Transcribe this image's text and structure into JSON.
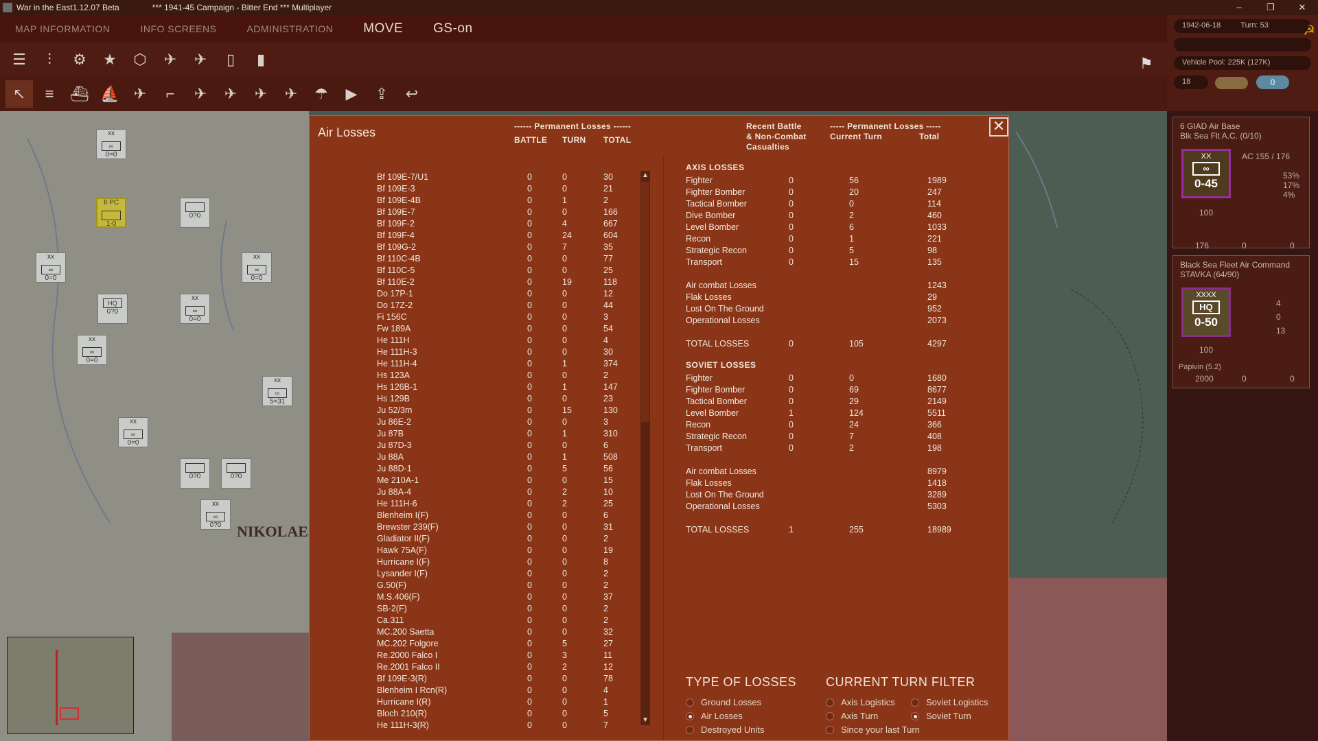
{
  "window": {
    "app_title": "War in the East1.12.07 Beta",
    "campaign_title": "***   1941-45 Campaign - Bitter End   ***  Multiplayer",
    "minimize": "–",
    "maximize": "❐",
    "close": "✕"
  },
  "menubar": {
    "items": [
      "MAP INFORMATION",
      "INFO SCREENS",
      "ADMINISTRATION",
      "MOVE",
      "GS-on"
    ]
  },
  "status": {
    "date": "1942-06-18",
    "turn": "Turn: 53",
    "vehicle_pool": "Vehicle Pool: 225K (127K)",
    "counter": "18",
    "indicator": "0"
  },
  "map": {
    "city_label": "NIKOLAE",
    "counters": [
      {
        "top": "xx",
        "val": "0=0"
      },
      {
        "top": "II PC",
        "val": "1-0"
      },
      {
        "top": "",
        "val": "0?0"
      },
      {
        "top": "xx",
        "val": "0=0"
      },
      {
        "top": "xx",
        "val": "0=0"
      },
      {
        "top": "HQ",
        "val": "0?0"
      },
      {
        "top": "xx",
        "val": "0=0"
      },
      {
        "top": "xx",
        "val": "0=0"
      },
      {
        "top": "xx",
        "val": "5=31"
      },
      {
        "top": "xx",
        "val": "0=0"
      },
      {
        "top": "",
        "val": "0?0"
      },
      {
        "top": "",
        "val": "0?0"
      },
      {
        "top": "xx",
        "val": "0?0"
      }
    ]
  },
  "right_panel": {
    "unit1": {
      "name": "6 GIAD Air Base",
      "subname": "Blk Sea Flt A.C. (0/10)",
      "corps": "XX",
      "strength": "0-45",
      "ac": "AC  155 / 176",
      "pct1": "53%",
      "pct2": "17%",
      "pct3": "4%",
      "morale": "100",
      "planes": "176",
      "stat2": "0",
      "stat3": "0"
    },
    "unit2": {
      "name": "Black Sea Fleet Air Command",
      "subname": "STAVKA  (64/90)",
      "corps": "XXXX",
      "hq": "HQ",
      "strength": "0-50",
      "s1": "4",
      "s2": "0",
      "s3": "13",
      "morale": "100",
      "leader": "Papivin (5.2)",
      "men": "2000",
      "a": "0",
      "b": "0"
    }
  },
  "dialog": {
    "title": "Air Losses",
    "perm_header_left": "------ Permanent Losses ------",
    "col_battle": "BATTLE",
    "col_turn": "TURN",
    "col_total": "TOTAL",
    "recent_header": "Recent Battle\n& Non-Combat\nCasualties",
    "perm_header_right": "----- Permanent Losses -----",
    "col_current_turn": "Current Turn",
    "col_total_right": "Total",
    "close": "✕",
    "rows": [
      [
        "Bf 109E-7/U1",
        "0",
        "0",
        "30"
      ],
      [
        "Bf 109E-3",
        "0",
        "0",
        "21"
      ],
      [
        "Bf 109E-4B",
        "0",
        "1",
        "2"
      ],
      [
        "Bf 109E-7",
        "0",
        "0",
        "166"
      ],
      [
        "Bf 109F-2",
        "0",
        "4",
        "667"
      ],
      [
        "Bf 109F-4",
        "0",
        "24",
        "604"
      ],
      [
        "Bf 109G-2",
        "0",
        "7",
        "35"
      ],
      [
        "Bf 110C-4B",
        "0",
        "0",
        "77"
      ],
      [
        "Bf 110C-5",
        "0",
        "0",
        "25"
      ],
      [
        "Bf 110E-2",
        "0",
        "19",
        "118"
      ],
      [
        "Do 17P-1",
        "0",
        "0",
        "12"
      ],
      [
        "Do 17Z-2",
        "0",
        "0",
        "44"
      ],
      [
        "Fi 156C",
        "0",
        "0",
        "3"
      ],
      [
        "Fw 189A",
        "0",
        "0",
        "54"
      ],
      [
        "He 111H",
        "0",
        "0",
        "4"
      ],
      [
        "He 111H-3",
        "0",
        "0",
        "30"
      ],
      [
        "He 111H-4",
        "0",
        "1",
        "374"
      ],
      [
        "Hs 123A",
        "0",
        "0",
        "2"
      ],
      [
        "Hs 126B-1",
        "0",
        "1",
        "147"
      ],
      [
        "Hs 129B",
        "0",
        "0",
        "23"
      ],
      [
        "Ju 52/3m",
        "0",
        "15",
        "130"
      ],
      [
        "Ju 86E-2",
        "0",
        "0",
        "3"
      ],
      [
        "Ju 87B",
        "0",
        "1",
        "310"
      ],
      [
        "Ju 87D-3",
        "0",
        "0",
        "6"
      ],
      [
        "Ju 88A",
        "0",
        "1",
        "508"
      ],
      [
        "Ju 88D-1",
        "0",
        "5",
        "56"
      ],
      [
        "Me 210A-1",
        "0",
        "0",
        "15"
      ],
      [
        "Ju 88A-4",
        "0",
        "2",
        "10"
      ],
      [
        "He 111H-6",
        "0",
        "2",
        "25"
      ],
      [
        "Blenheim I(F)",
        "0",
        "0",
        "6"
      ],
      [
        "Brewster 239(F)",
        "0",
        "0",
        "31"
      ],
      [
        "Gladiator II(F)",
        "0",
        "0",
        "2"
      ],
      [
        "Hawk 75A(F)",
        "0",
        "0",
        "19"
      ],
      [
        "Hurricane I(F)",
        "0",
        "0",
        "8"
      ],
      [
        "Lysander I(F)",
        "0",
        "0",
        "2"
      ],
      [
        "G.50(F)",
        "0",
        "0",
        "2"
      ],
      [
        "M.S.406(F)",
        "0",
        "0",
        "37"
      ],
      [
        "SB-2(F)",
        "0",
        "0",
        "2"
      ],
      [
        "Ca.311",
        "0",
        "0",
        "2"
      ],
      [
        "MC.200 Saetta",
        "0",
        "0",
        "32"
      ],
      [
        "MC.202 Folgore",
        "0",
        "5",
        "27"
      ],
      [
        "Re.2000 Falco I",
        "0",
        "3",
        "11"
      ],
      [
        "Re.2001 Falco II",
        "0",
        "2",
        "12"
      ],
      [
        "Bf 109E-3(R)",
        "0",
        "0",
        "78"
      ],
      [
        "Blenheim I Rcn(R)",
        "0",
        "0",
        "4"
      ],
      [
        "Hurricane I(R)",
        "0",
        "0",
        "1"
      ],
      [
        "Bloch 210(R)",
        "0",
        "0",
        "5"
      ],
      [
        "He 111H-3(R)",
        "0",
        "0",
        "7"
      ]
    ],
    "axis": {
      "title": "AXIS LOSSES",
      "types": [
        [
          "Fighter",
          "0",
          "56",
          "1989"
        ],
        [
          "Fighter Bomber",
          "0",
          "20",
          "247"
        ],
        [
          "Tactical Bomber",
          "0",
          "0",
          "114"
        ],
        [
          "Dive Bomber",
          "0",
          "2",
          "460"
        ],
        [
          "Level Bomber",
          "0",
          "6",
          "1033"
        ],
        [
          "Recon",
          "0",
          "1",
          "221"
        ],
        [
          "Strategic Recon",
          "0",
          "5",
          "98"
        ],
        [
          "Transport",
          "0",
          "15",
          "135"
        ]
      ],
      "causes": [
        [
          "Air combat Losses",
          "1243"
        ],
        [
          "Flak Losses",
          "29"
        ],
        [
          "Lost On The Ground",
          "952"
        ],
        [
          "Operational Losses",
          "2073"
        ]
      ],
      "total": [
        "TOTAL LOSSES",
        "0",
        "105",
        "4297"
      ]
    },
    "soviet": {
      "title": "SOVIET LOSSES",
      "types": [
        [
          "Fighter",
          "0",
          "0",
          "1680"
        ],
        [
          "Fighter Bomber",
          "0",
          "69",
          "8677"
        ],
        [
          "Tactical Bomber",
          "0",
          "29",
          "2149"
        ],
        [
          "Level Bomber",
          "1",
          "124",
          "5511"
        ],
        [
          "Recon",
          "0",
          "24",
          "366"
        ],
        [
          "Strategic Recon",
          "0",
          "7",
          "408"
        ],
        [
          "Transport",
          "0",
          "2",
          "198"
        ]
      ],
      "causes": [
        [
          "Air combat Losses",
          "8979"
        ],
        [
          "Flak Losses",
          "1418"
        ],
        [
          "Lost On The Ground",
          "3289"
        ],
        [
          "Operational Losses",
          "5303"
        ]
      ],
      "total": [
        "TOTAL LOSSES",
        "1",
        "255",
        "18989"
      ]
    },
    "type_of_losses": {
      "title": "TYPE OF LOSSES",
      "options": [
        "Ground Losses",
        "Air Losses",
        "Destroyed Units"
      ],
      "selected": 1
    },
    "turn_filter": {
      "title": "CURRENT TURN FILTER",
      "options": [
        "Axis Logistics",
        "Soviet Logistics",
        "Axis Turn",
        "Soviet Turn",
        "Since your last Turn"
      ],
      "selected": 3
    }
  }
}
